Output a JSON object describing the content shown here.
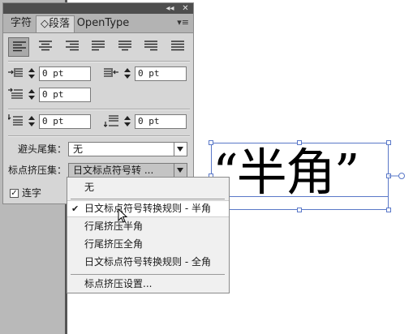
{
  "panel": {
    "topbar": {
      "collapse_glyph": "◂◂",
      "close_glyph": "✕"
    },
    "tabs": [
      {
        "label": "字符"
      },
      {
        "label": "◇段落"
      },
      {
        "label": "OpenType"
      }
    ],
    "menu_glyph": "▾≡",
    "alignment": {
      "buttons": [
        "align-left",
        "align-center",
        "align-right",
        "justify-left",
        "justify-center",
        "justify-right",
        "justify-all"
      ],
      "selected_index": 0
    },
    "indents": {
      "left_indent": "0 pt",
      "right_indent": "0 pt",
      "first_line_indent": "0 pt",
      "space_before": "0 pt",
      "space_after": "0 pt"
    },
    "kinsoku": {
      "label": "避头尾集：",
      "value": "无"
    },
    "mojikumi": {
      "label": "标点挤压集：",
      "value": "日文标点符号转 ..."
    },
    "hyphenate": {
      "label": "连字",
      "checked": true
    }
  },
  "dropdown": {
    "items": [
      {
        "label": "无",
        "checked": false
      },
      {
        "label": "日文标点符号转换规则 - 半角",
        "checked": true
      },
      {
        "label": "行尾挤压半角",
        "checked": false
      },
      {
        "label": "行尾挤压全角",
        "checked": false
      },
      {
        "label": "日文标点符号转换规则 - 全角",
        "checked": false
      },
      {
        "label": "标点挤压设置...",
        "checked": false
      }
    ],
    "check_glyph": "✔"
  },
  "canvas": {
    "text": "“半角”"
  },
  "colors": {
    "selection_blue": "#5a78c8",
    "panel_bg": "#d6d6d6"
  }
}
